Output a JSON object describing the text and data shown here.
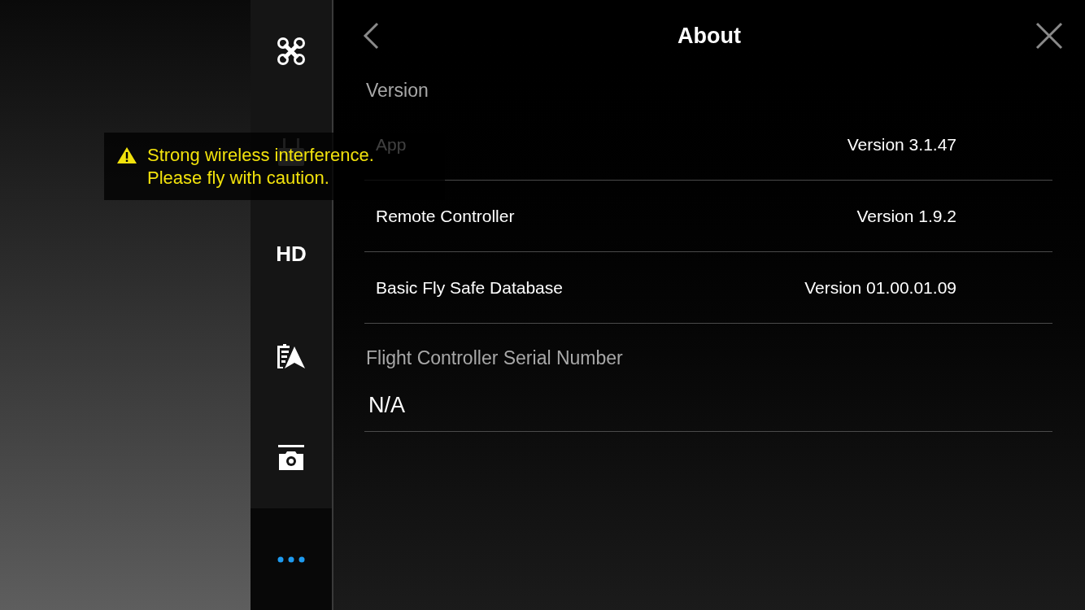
{
  "sidebar": {
    "items": [
      {
        "kind": "drone",
        "selected": false
      },
      {
        "kind": "remote",
        "selected": false
      },
      {
        "kind": "hd",
        "label": "HD",
        "selected": false
      },
      {
        "kind": "battery",
        "selected": false
      },
      {
        "kind": "camera",
        "selected": false
      },
      {
        "kind": "more",
        "selected": true
      }
    ]
  },
  "header": {
    "title": "About"
  },
  "sections": [
    {
      "title": "Version",
      "rows": [
        {
          "label": "App",
          "value": "Version 3.1.47"
        },
        {
          "label": "Remote Controller",
          "value": "Version 1.9.2"
        },
        {
          "label": "Basic Fly Safe Database",
          "value": "Version 01.00.01.09"
        }
      ]
    },
    {
      "title": "Flight Controller Serial Number",
      "value": "N/A"
    }
  ],
  "toast": {
    "lines": [
      "Strong wireless interference.",
      "Please fly with caution."
    ]
  }
}
